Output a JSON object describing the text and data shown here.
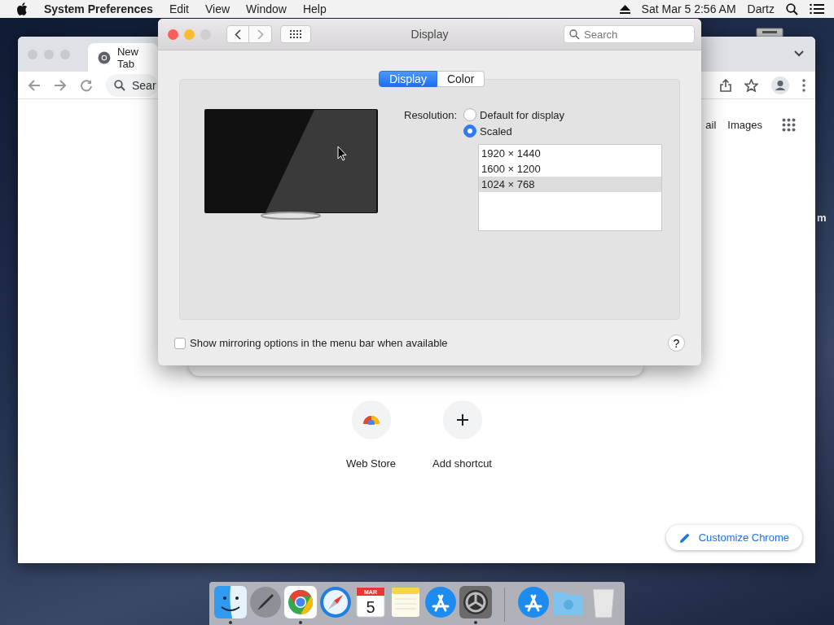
{
  "menu_bar": {
    "app_name": "System Preferences",
    "items": [
      "Edit",
      "View",
      "Window",
      "Help"
    ],
    "clock": "Sat Mar 5  2:56 AM",
    "user": "Dartz"
  },
  "desktop": {
    "icon_label": "m"
  },
  "browser": {
    "tab_title": "New Tab",
    "omnibox_text": "Sear",
    "links": [
      "ail",
      "Images"
    ],
    "shortcuts": [
      {
        "kind": "store",
        "label": "Web Store"
      },
      {
        "kind": "add",
        "label": "Add shortcut"
      }
    ],
    "customize_button": "Customize Chrome"
  },
  "prefs_window": {
    "title": "Display",
    "search": {
      "placeholder": "Search"
    },
    "tabs": [
      {
        "label": "Display",
        "selected": true
      },
      {
        "label": "Color",
        "selected": false
      }
    ],
    "resolution_label": "Resolution:",
    "options": [
      {
        "label": "Default for display",
        "selected": false
      },
      {
        "label": "Scaled",
        "selected": true
      }
    ],
    "resolutions": [
      {
        "label": "1920 × 1440",
        "selected": false
      },
      {
        "label": "1600 × 1200",
        "selected": false
      },
      {
        "label": "1024 × 768",
        "selected": true
      }
    ],
    "mirroring": {
      "label": "Show mirroring options in the menu bar when available",
      "checked": false
    },
    "help": "?"
  },
  "dock": {
    "apps": [
      {
        "kind": "finder",
        "running": true
      },
      {
        "kind": "launchpad",
        "running": false
      },
      {
        "kind": "chrome",
        "running": true
      },
      {
        "kind": "safari",
        "running": false
      },
      {
        "kind": "calendar",
        "running": false,
        "month": "MAR",
        "day": "5"
      },
      {
        "kind": "notes",
        "running": false
      },
      {
        "kind": "appstore",
        "running": false
      },
      {
        "kind": "settings",
        "running": true
      },
      {
        "kind": "separator"
      },
      {
        "kind": "appstore",
        "running": false
      },
      {
        "kind": "downloads",
        "running": false
      },
      {
        "kind": "trash",
        "running": false
      }
    ]
  }
}
